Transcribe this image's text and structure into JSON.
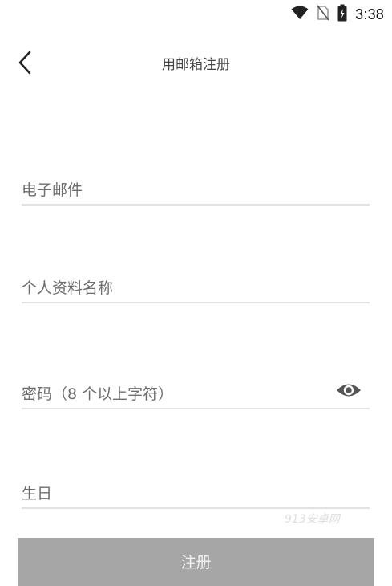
{
  "status_bar": {
    "time": "3:38",
    "icons": [
      "wifi-icon",
      "no-sim-icon",
      "battery-icon"
    ]
  },
  "header": {
    "title": "用邮箱注册",
    "back_icon": "chevron-left-icon"
  },
  "form": {
    "email_placeholder": "电子邮件",
    "name_placeholder": "个人资料名称",
    "password_placeholder": "密码（8 个以上字符）",
    "password_toggle_icon": "eye-icon",
    "birthday_placeholder": "生日"
  },
  "watermark": "913安卓网",
  "register_label": "注册",
  "colors": {
    "button_bg": "#a6a6a6",
    "button_text": "#f2f2f2",
    "divider": "#e2e2e2",
    "placeholder": "#6e6e6e"
  }
}
